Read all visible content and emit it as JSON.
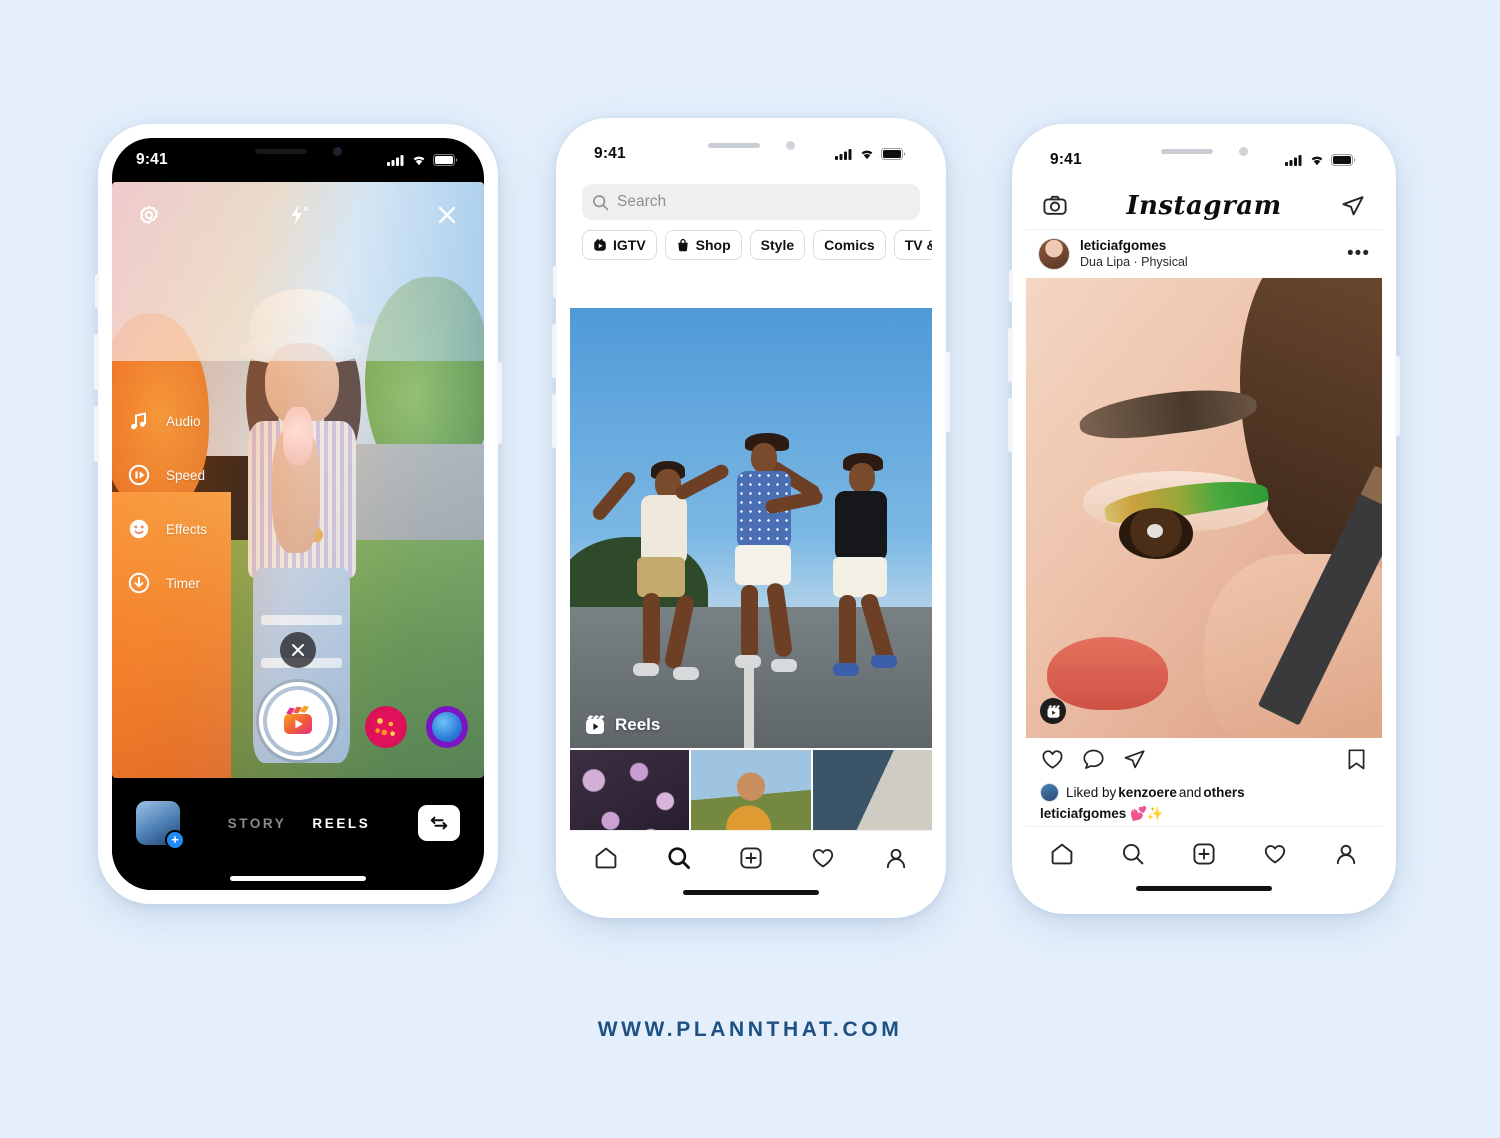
{
  "background_color": "#e4effb",
  "footer": {
    "url": "WWW.PLANNTHAT.COM",
    "color": "#1d5183"
  },
  "phone_camera": {
    "status_bar": {
      "time": "9:41"
    },
    "top_controls": [
      {
        "name": "settings-icon",
        "label": "Settings"
      },
      {
        "name": "flash-off-icon",
        "label": "Flash off"
      },
      {
        "name": "close-icon",
        "label": "Close"
      }
    ],
    "side_tools": [
      {
        "icon": "music-note-icon",
        "label": "Audio"
      },
      {
        "icon": "speed-icon",
        "label": "Speed"
      },
      {
        "icon": "smiley-face-icon",
        "label": "Effects"
      },
      {
        "icon": "timer-icon",
        "label": "Timer"
      }
    ],
    "clear_effect_label": "Clear effect",
    "shutter_label": "Record",
    "effects": [
      {
        "name": "effect-confetti",
        "colors": [
          "#e8145e",
          "#ffd24a"
        ]
      },
      {
        "name": "effect-blue-orb",
        "colors": [
          "#7b15c4",
          "#2f7fdc"
        ]
      }
    ],
    "gallery_label": "Gallery",
    "mode_tabs": [
      {
        "label": "STORY",
        "active": false
      },
      {
        "label": "REELS",
        "active": true
      }
    ],
    "flip_camera_label": "Flip camera"
  },
  "phone_explore": {
    "status_bar": {
      "time": "9:41"
    },
    "search": {
      "placeholder": "Search",
      "value": ""
    },
    "category_chips": [
      {
        "label": "IGTV",
        "icon": "igtv-icon"
      },
      {
        "label": "Shop",
        "icon": "shopping-bag-icon"
      },
      {
        "label": "Style",
        "icon": ""
      },
      {
        "label": "Comics",
        "icon": ""
      },
      {
        "label": "TV & Movies",
        "icon": ""
      }
    ],
    "hero": {
      "badge_label": "Reels",
      "badge_icon": "reels-icon"
    },
    "grid_tiles": [
      {
        "name": "tile-flowers",
        "colors": [
          "#c9a8cf",
          "#4a3350"
        ]
      },
      {
        "name": "tile-piggyback",
        "colors": [
          "#8fb8d8",
          "#d8913a"
        ]
      },
      {
        "name": "tile-skateboard",
        "colors": [
          "#3f5c74",
          "#c9c4bb"
        ]
      },
      {
        "name": "tile-hands-sky",
        "colors": [
          "#6aa6dd",
          "#d8b59c"
        ]
      },
      {
        "name": "tile-red-fabric",
        "colors": [
          "#c2242c",
          "#7d1218"
        ]
      },
      {
        "name": "tile-dark-portrait",
        "colors": [
          "#2f2a22",
          "#6b5a41"
        ]
      }
    ],
    "tab_bar": [
      {
        "name": "home-icon",
        "label": "Home",
        "active": false
      },
      {
        "name": "search-icon",
        "label": "Search",
        "active": true
      },
      {
        "name": "add-post-icon",
        "label": "New post",
        "active": false
      },
      {
        "name": "activity-heart-icon",
        "label": "Activity",
        "active": false
      },
      {
        "name": "profile-icon",
        "label": "Profile",
        "active": false
      }
    ]
  },
  "phone_feed": {
    "status_bar": {
      "time": "9:41"
    },
    "header": {
      "camera_label": "Camera",
      "wordmark": "Instagram",
      "direct_label": "Direct messages"
    },
    "post": {
      "username": "leticiafgomes",
      "music": "Dua Lipa · Physical",
      "more_label": "•••",
      "reel_badge_label": "Reel",
      "actions": [
        {
          "name": "like-icon",
          "label": "Like"
        },
        {
          "name": "comment-icon",
          "label": "Comment"
        },
        {
          "name": "share-icon",
          "label": "Share"
        },
        {
          "name": "save-bookmark-icon",
          "label": "Save"
        }
      ],
      "likes_prefix": "Liked by ",
      "likes_user": "kenzoere",
      "likes_middle": " and ",
      "likes_suffix": "others",
      "caption_user": "leticiafgomes",
      "caption_text": " 💕✨"
    },
    "tab_bar": [
      {
        "name": "home-icon",
        "label": "Home",
        "active": true
      },
      {
        "name": "search-icon",
        "label": "Search",
        "active": false
      },
      {
        "name": "add-post-icon",
        "label": "New post",
        "active": false
      },
      {
        "name": "activity-heart-icon",
        "label": "Activity",
        "active": false
      },
      {
        "name": "profile-icon",
        "label": "Profile",
        "active": false
      }
    ]
  }
}
